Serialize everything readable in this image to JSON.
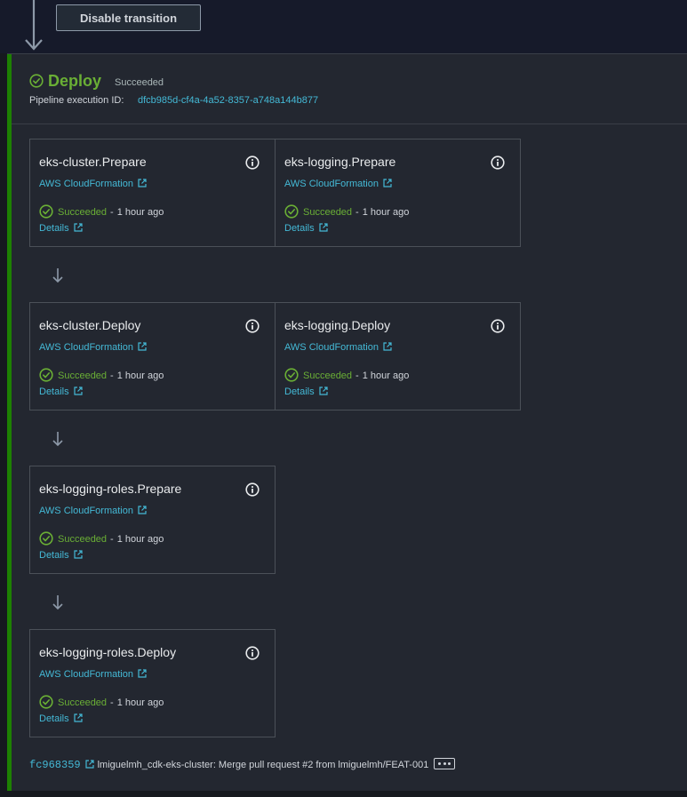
{
  "transition": {
    "button_label": "Disable transition"
  },
  "stage": {
    "name": "Deploy",
    "status": "Succeeded",
    "execution_label": "Pipeline execution ID:",
    "execution_id": "dfcb985d-cf4a-4a52-8357-a748a144b877"
  },
  "actions": [
    {
      "name": "eks-cluster.Prepare",
      "provider": "AWS CloudFormation",
      "status": "Succeeded",
      "time": "1 hour ago",
      "details": "Details"
    },
    {
      "name": "eks-logging.Prepare",
      "provider": "AWS CloudFormation",
      "status": "Succeeded",
      "time": "1 hour ago",
      "details": "Details"
    },
    {
      "name": "eks-cluster.Deploy",
      "provider": "AWS CloudFormation",
      "status": "Succeeded",
      "time": "1 hour ago",
      "details": "Details"
    },
    {
      "name": "eks-logging.Deploy",
      "provider": "AWS CloudFormation",
      "status": "Succeeded",
      "time": "1 hour ago",
      "details": "Details"
    },
    {
      "name": "eks-logging-roles.Prepare",
      "provider": "AWS CloudFormation",
      "status": "Succeeded",
      "time": "1 hour ago",
      "details": "Details"
    },
    {
      "name": "eks-logging-roles.Deploy",
      "provider": "AWS CloudFormation",
      "status": "Succeeded",
      "time": "1 hour ago",
      "details": "Details"
    }
  ],
  "separator": "-",
  "commit": {
    "id": "fc968359",
    "message": "lmiguelmh_cdk-eks-cluster: Merge pull request #2 from lmiguelmh/FEAT-001"
  },
  "icons": {
    "success": "check-circle-icon",
    "info": "info-icon",
    "external": "external-link-icon",
    "arrow": "arrow-down-icon",
    "more": "ellipsis-icon"
  },
  "colors": {
    "success": "#6aaf35",
    "link": "#44b9d6",
    "stage_bar": "#1d8102",
    "background": "#232730"
  }
}
